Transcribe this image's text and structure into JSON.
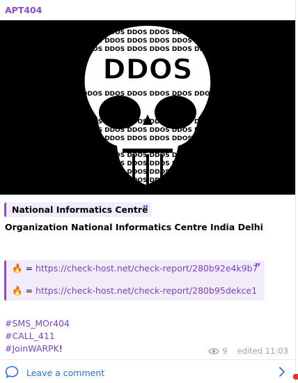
{
  "channel": {
    "name": "APT404"
  },
  "media": {
    "alt": "DDOS skull artwork",
    "skull_word": "DDOS"
  },
  "quote": {
    "title": "National Informatics Centre"
  },
  "post": {
    "organization": "Organization National Informatics Centre India Delhi"
  },
  "links": [
    {
      "emoji": "🔥",
      "sep": "=",
      "url": "https://check-host.net/check-report/280b92e4k9b7"
    },
    {
      "emoji": "🔥",
      "sep": "=",
      "url": "https://check-host.net/check-report/280b95dekce1"
    }
  ],
  "hashtags": [
    "#SMS_MOr404",
    "#CALL_411",
    "#JoinWARPK"
  ],
  "hashtag_suffix": "!",
  "meta": {
    "views": "9",
    "edited": "edited 11:03"
  },
  "comment": {
    "label": "Leave a comment"
  },
  "colors": {
    "accent": "#8a4fc7",
    "link": "#7a43c2",
    "comment": "#2e6fc4"
  }
}
